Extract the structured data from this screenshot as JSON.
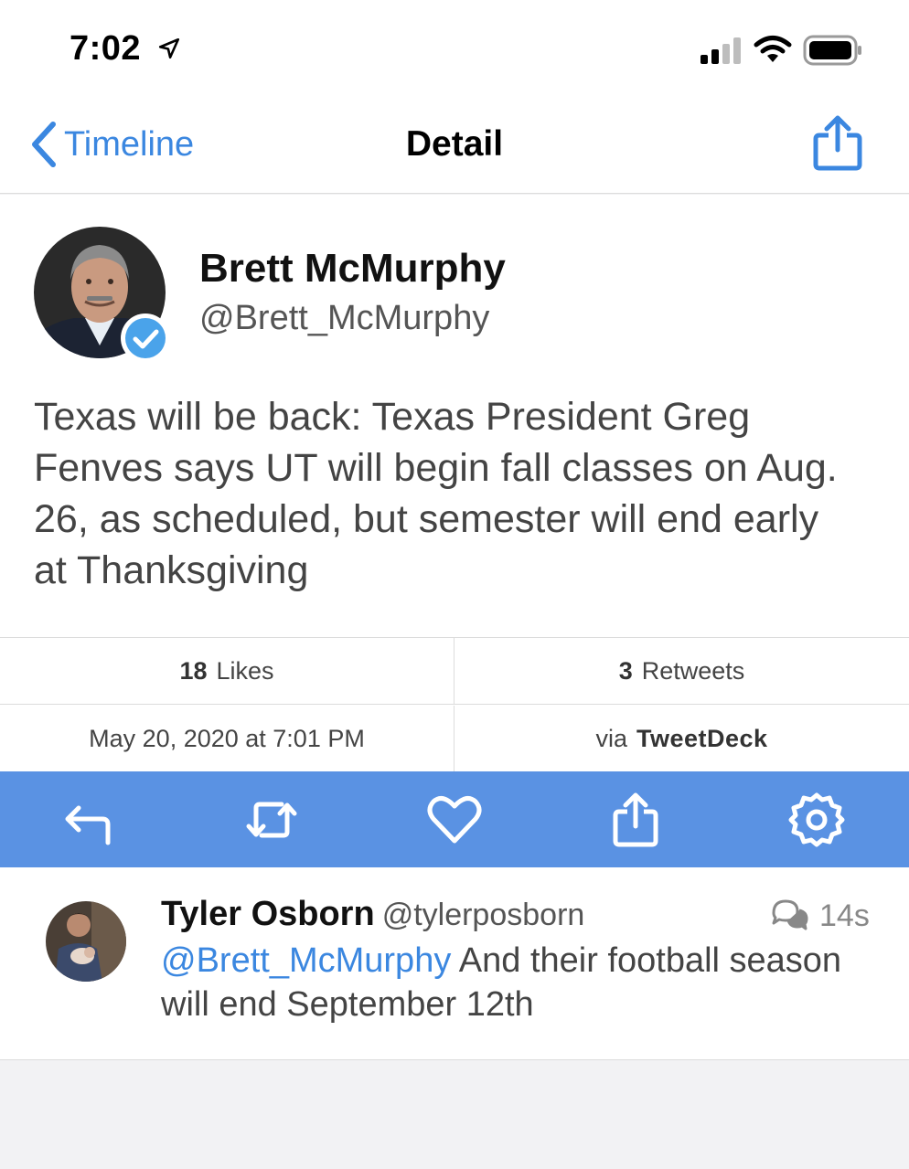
{
  "status_bar": {
    "time": "7:02"
  },
  "nav": {
    "back_label": "Timeline",
    "title": "Detail"
  },
  "tweet": {
    "author_name": "Brett McMurphy",
    "author_handle": "@Brett_McMurphy",
    "text": "Texas will be back: Texas President Greg Fenves says UT will begin fall classes on Aug. 26, as scheduled, but semester will end early at Thanksgiving"
  },
  "stats": {
    "likes_count": "18",
    "likes_label": "Likes",
    "retweets_count": "3",
    "retweets_label": "Retweets",
    "date": "May 20, 2020 at 7:01 PM",
    "via_label": "via",
    "via_app": "TweetDeck"
  },
  "actions": {
    "icons": [
      "reply-icon",
      "retweet-icon",
      "like-icon",
      "share-icon",
      "settings-icon"
    ]
  },
  "reply": {
    "author_name": "Tyler Osborn",
    "author_handle": "@tylerposborn",
    "time": "14s",
    "mention": "@Brett_McMurphy",
    "text": " And their football season will end September 12th"
  },
  "colors": {
    "accent": "#3b87e0",
    "action_bar": "#5a92e3",
    "background": "#f2f2f4"
  }
}
